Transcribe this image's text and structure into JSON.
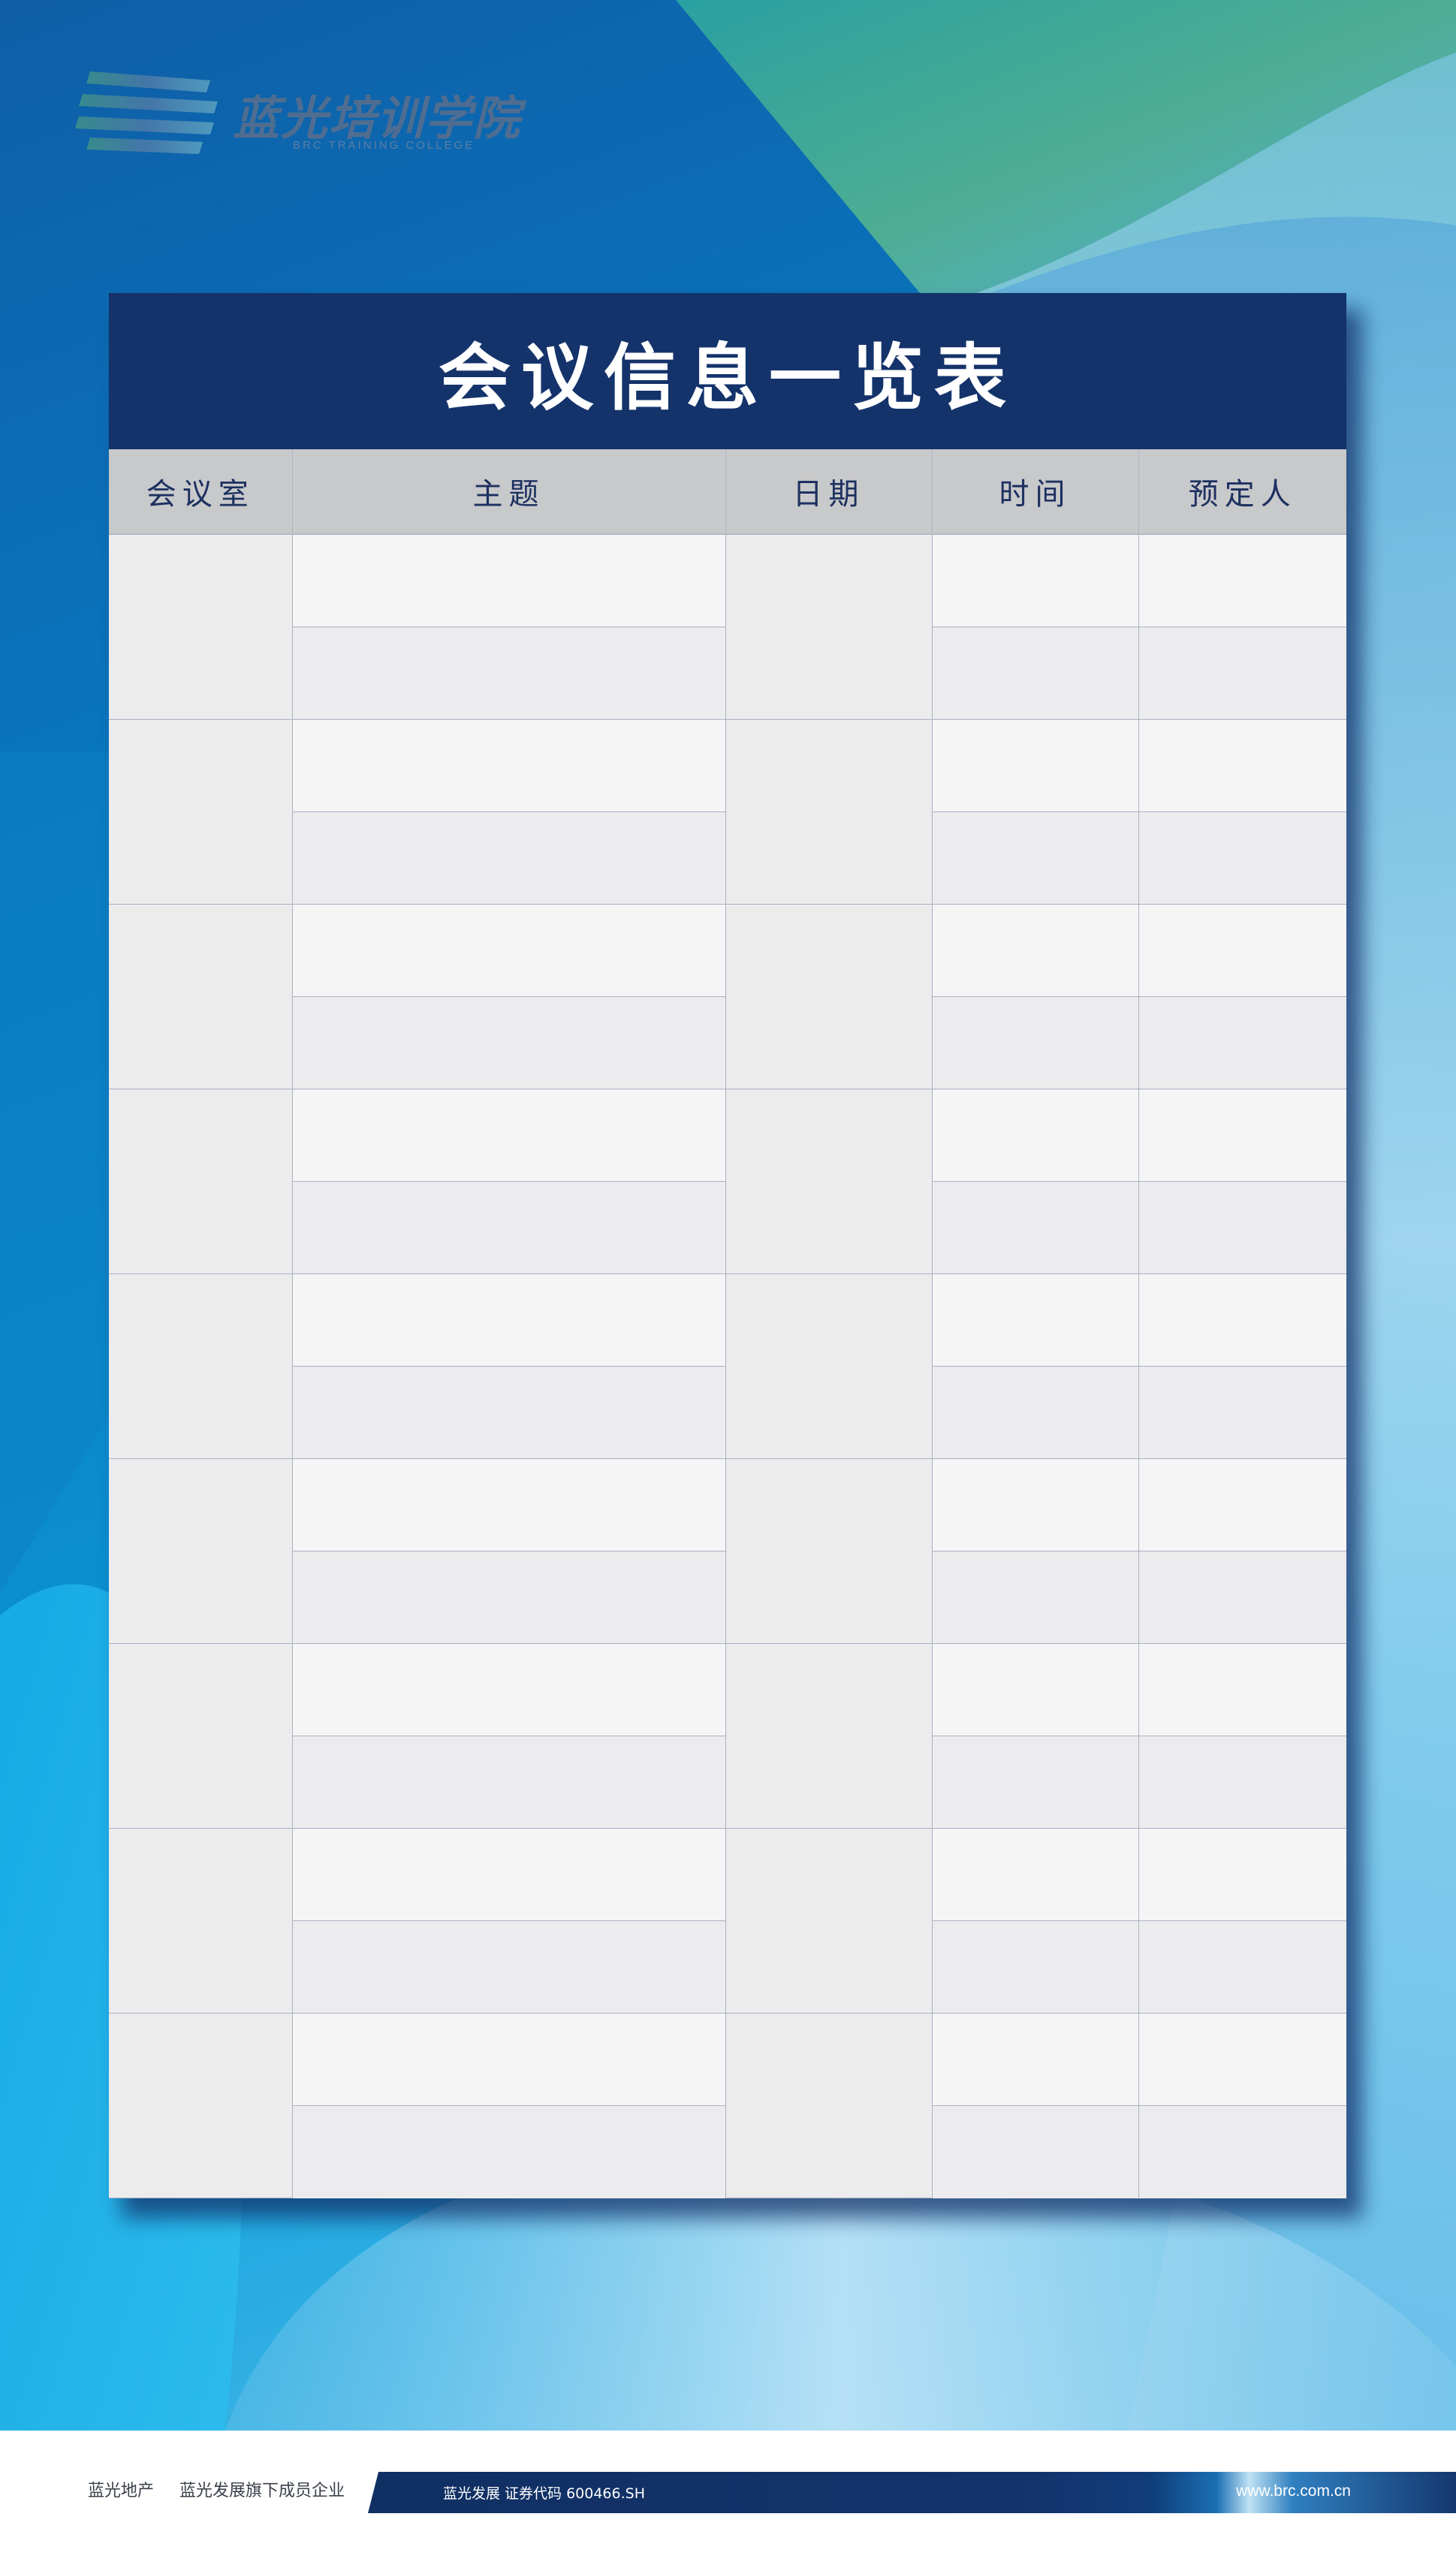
{
  "logo": {
    "name_cn": "蓝光培训学院",
    "name_en": "BRC TRAINING COLLEGE"
  },
  "board": {
    "title": "会议信息一览表",
    "columns": [
      "会议室",
      "主题",
      "日期",
      "时间",
      "预定人"
    ],
    "group_count": 9,
    "rows_per_group": 2
  },
  "footer": {
    "company": "蓝光地产",
    "tagline": "蓝光发展旗下成员企业",
    "stock": "蓝光发展 证券代码 600466.SH",
    "url": "www.brc.com.cn"
  },
  "colors": {
    "header_navy": "#14336b",
    "column_header_gray": "#c8c9cb",
    "cell_light": "#f5f5f6",
    "cell_alt": "#ececee",
    "background_blue": "#0877bf"
  }
}
